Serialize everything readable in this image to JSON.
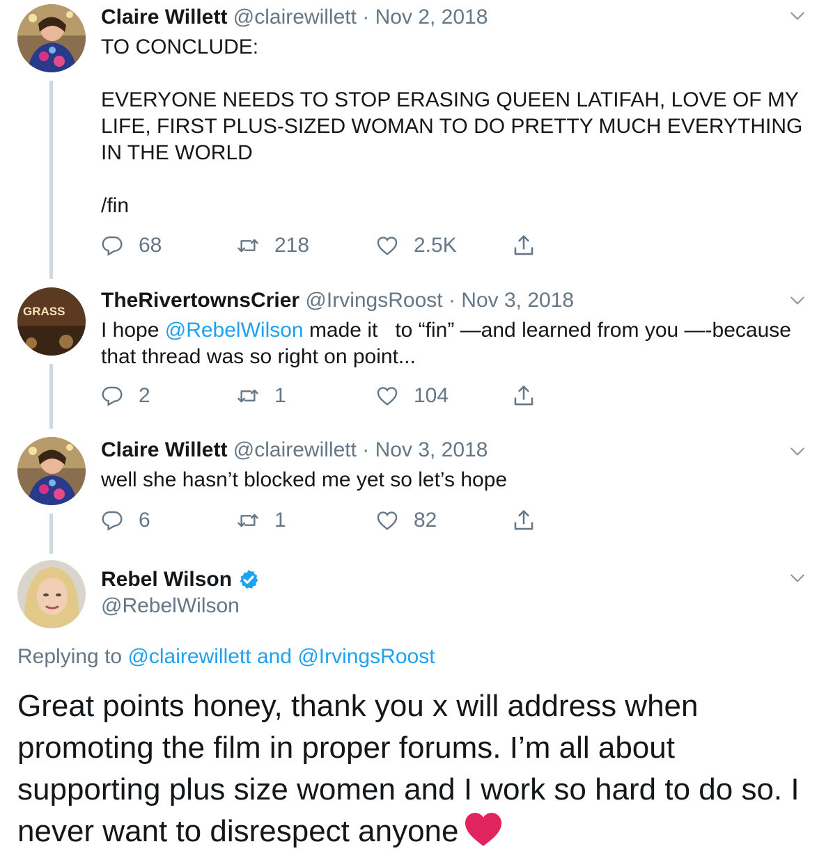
{
  "tweets": [
    {
      "name": "Claire Willett",
      "handle": "@clairewillett",
      "dot": "·",
      "date": "Nov 2, 2018",
      "text": "TO CONCLUDE:\n\nEVERYONE NEEDS TO STOP ERASING QUEEN LATIFAH, LOVE OF MY LIFE, FIRST PLUS-SIZED WOMAN TO DO PRETTY MUCH EVERYTHING IN THE WORLD\n\n/fin",
      "replies": "68",
      "retweets": "218",
      "likes": "2.5K"
    },
    {
      "name": "TheRivertownsCrier",
      "handle": "@IrvingsRoost",
      "dot": "·",
      "date": "Nov 3, 2018",
      "text_pre": "I hope ",
      "mention": "@RebelWilson",
      "text_post": " made it   to “fin” —and learned from you —-because that thread was so right on point...",
      "avatar_text": "GRASS",
      "replies": "2",
      "retweets": "1",
      "likes": "104"
    },
    {
      "name": "Claire Willett",
      "handle": "@clairewillett",
      "dot": "·",
      "date": "Nov 3, 2018",
      "text": "well she hasn’t blocked me yet so let’s hope",
      "replies": "6",
      "retweets": "1",
      "likes": "82"
    }
  ],
  "main_tweet": {
    "name": "Rebel Wilson",
    "handle": "@RebelWilson",
    "replying_label": "Replying to ",
    "replying_mention1": "@clairewillett",
    "replying_and": " and ",
    "replying_mention2": "@IrvingsRoost",
    "text": "Great points honey, thank you x will address when promoting the film in proper forums. I’m all about supporting plus size women and I work so hard to do so. I never want to disrespect anyone",
    "emoji": "red-heart"
  },
  "colors": {
    "link": "#1da1f2",
    "muted": "#657786",
    "text": "#14171a",
    "thread_line": "#cfd9de",
    "heart": "#e0245e"
  }
}
